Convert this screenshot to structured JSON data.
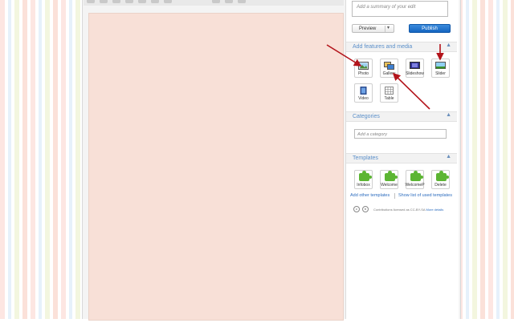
{
  "sidebar": {
    "summary_placeholder": "Add a summary of your edit",
    "preview_label": "Preview",
    "preview_dropdown": "▾",
    "publish_label": "Publish"
  },
  "features": {
    "title": "Add features and media",
    "collapse": "▲",
    "items": [
      {
        "label": "Photo",
        "icon": "photo-icon"
      },
      {
        "label": "Gallery",
        "icon": "gallery-icon"
      },
      {
        "label": "Slideshow",
        "icon": "slideshow-icon"
      },
      {
        "label": "Slider",
        "icon": "slider-icon"
      },
      {
        "label": "Video",
        "icon": "video-icon"
      },
      {
        "label": "Table",
        "icon": "table-icon"
      }
    ]
  },
  "categories": {
    "title": "Categories",
    "collapse": "▲",
    "input_placeholder": "Add a category"
  },
  "templates": {
    "title": "Templates",
    "collapse": "▲",
    "items": [
      {
        "label": "Infobox"
      },
      {
        "label": "Welcome"
      },
      {
        "label": "WelcomeP"
      },
      {
        "label": "Delete"
      }
    ],
    "add_other": "Add other templates",
    "show_list": "Show list of used templates"
  },
  "footer": {
    "license_text": "Contributions licensed as CC-BY-SA",
    "more_details": "More details"
  },
  "colors": {
    "edit_area": "#f8e0d7",
    "section_title": "#5a8fc9",
    "publish_button": "#1565c0",
    "annotation_arrow": "#b3141b"
  }
}
